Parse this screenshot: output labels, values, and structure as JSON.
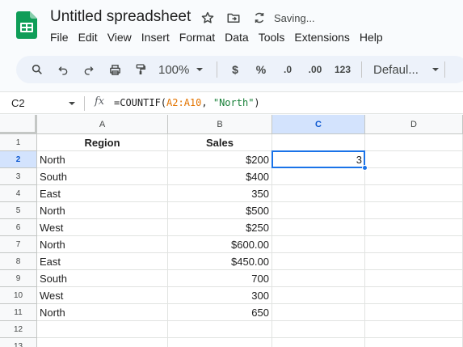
{
  "app": {
    "title": "Untitled spreadsheet",
    "status": "Saving...",
    "menu": [
      "File",
      "Edit",
      "View",
      "Insert",
      "Format",
      "Data",
      "Tools",
      "Extensions",
      "Help"
    ]
  },
  "toolbar": {
    "zoom": "100%",
    "currency": "$",
    "percent": "%",
    "decrease_decimal": ".0",
    "increase_decimal": ".00",
    "number_format": "123",
    "font": "Defaul..."
  },
  "formula_bar": {
    "cell_ref": "C2",
    "fx": "fx",
    "formula_prefix": "=COUNTIF(",
    "formula_range": "A2:A10",
    "formula_sep": ", ",
    "formula_string": "\"North\"",
    "formula_suffix": ")"
  },
  "sheet": {
    "columns": [
      "A",
      "B",
      "C",
      "D"
    ],
    "selected_column": "C",
    "selected_row": "2",
    "rows": [
      {
        "num": "1",
        "A": "Region",
        "B": "Sales",
        "C": "",
        "D": ""
      },
      {
        "num": "2",
        "A": "North",
        "B": "$200",
        "C": "3",
        "D": ""
      },
      {
        "num": "3",
        "A": "South",
        "B": "$400",
        "C": "",
        "D": ""
      },
      {
        "num": "4",
        "A": "East",
        "B": "350",
        "C": "",
        "D": ""
      },
      {
        "num": "5",
        "A": "North",
        "B": "$500",
        "C": "",
        "D": ""
      },
      {
        "num": "6",
        "A": "West",
        "B": "$250",
        "C": "",
        "D": ""
      },
      {
        "num": "7",
        "A": "North",
        "B": "$600.00",
        "C": "",
        "D": ""
      },
      {
        "num": "8",
        "A": "East",
        "B": "$450.00",
        "C": "",
        "D": ""
      },
      {
        "num": "9",
        "A": "South",
        "B": "700",
        "C": "",
        "D": ""
      },
      {
        "num": "10",
        "A": "West",
        "B": "300",
        "C": "",
        "D": ""
      },
      {
        "num": "11",
        "A": "North",
        "B": "650",
        "C": "",
        "D": ""
      },
      {
        "num": "12",
        "A": "",
        "B": "",
        "C": "",
        "D": ""
      },
      {
        "num": "13",
        "A": "",
        "B": "",
        "C": "",
        "D": ""
      }
    ]
  },
  "colors": {
    "accent": "#1a73e8",
    "selected_header": "#d3e3fd",
    "brand_green": "#0f9d58"
  },
  "icons": [
    "sheets-logo-icon",
    "star-icon",
    "move-folder-icon",
    "cloud-sync-icon",
    "search-icon",
    "undo-icon",
    "redo-icon",
    "print-icon",
    "paint-format-icon",
    "chevron-down-icon"
  ]
}
